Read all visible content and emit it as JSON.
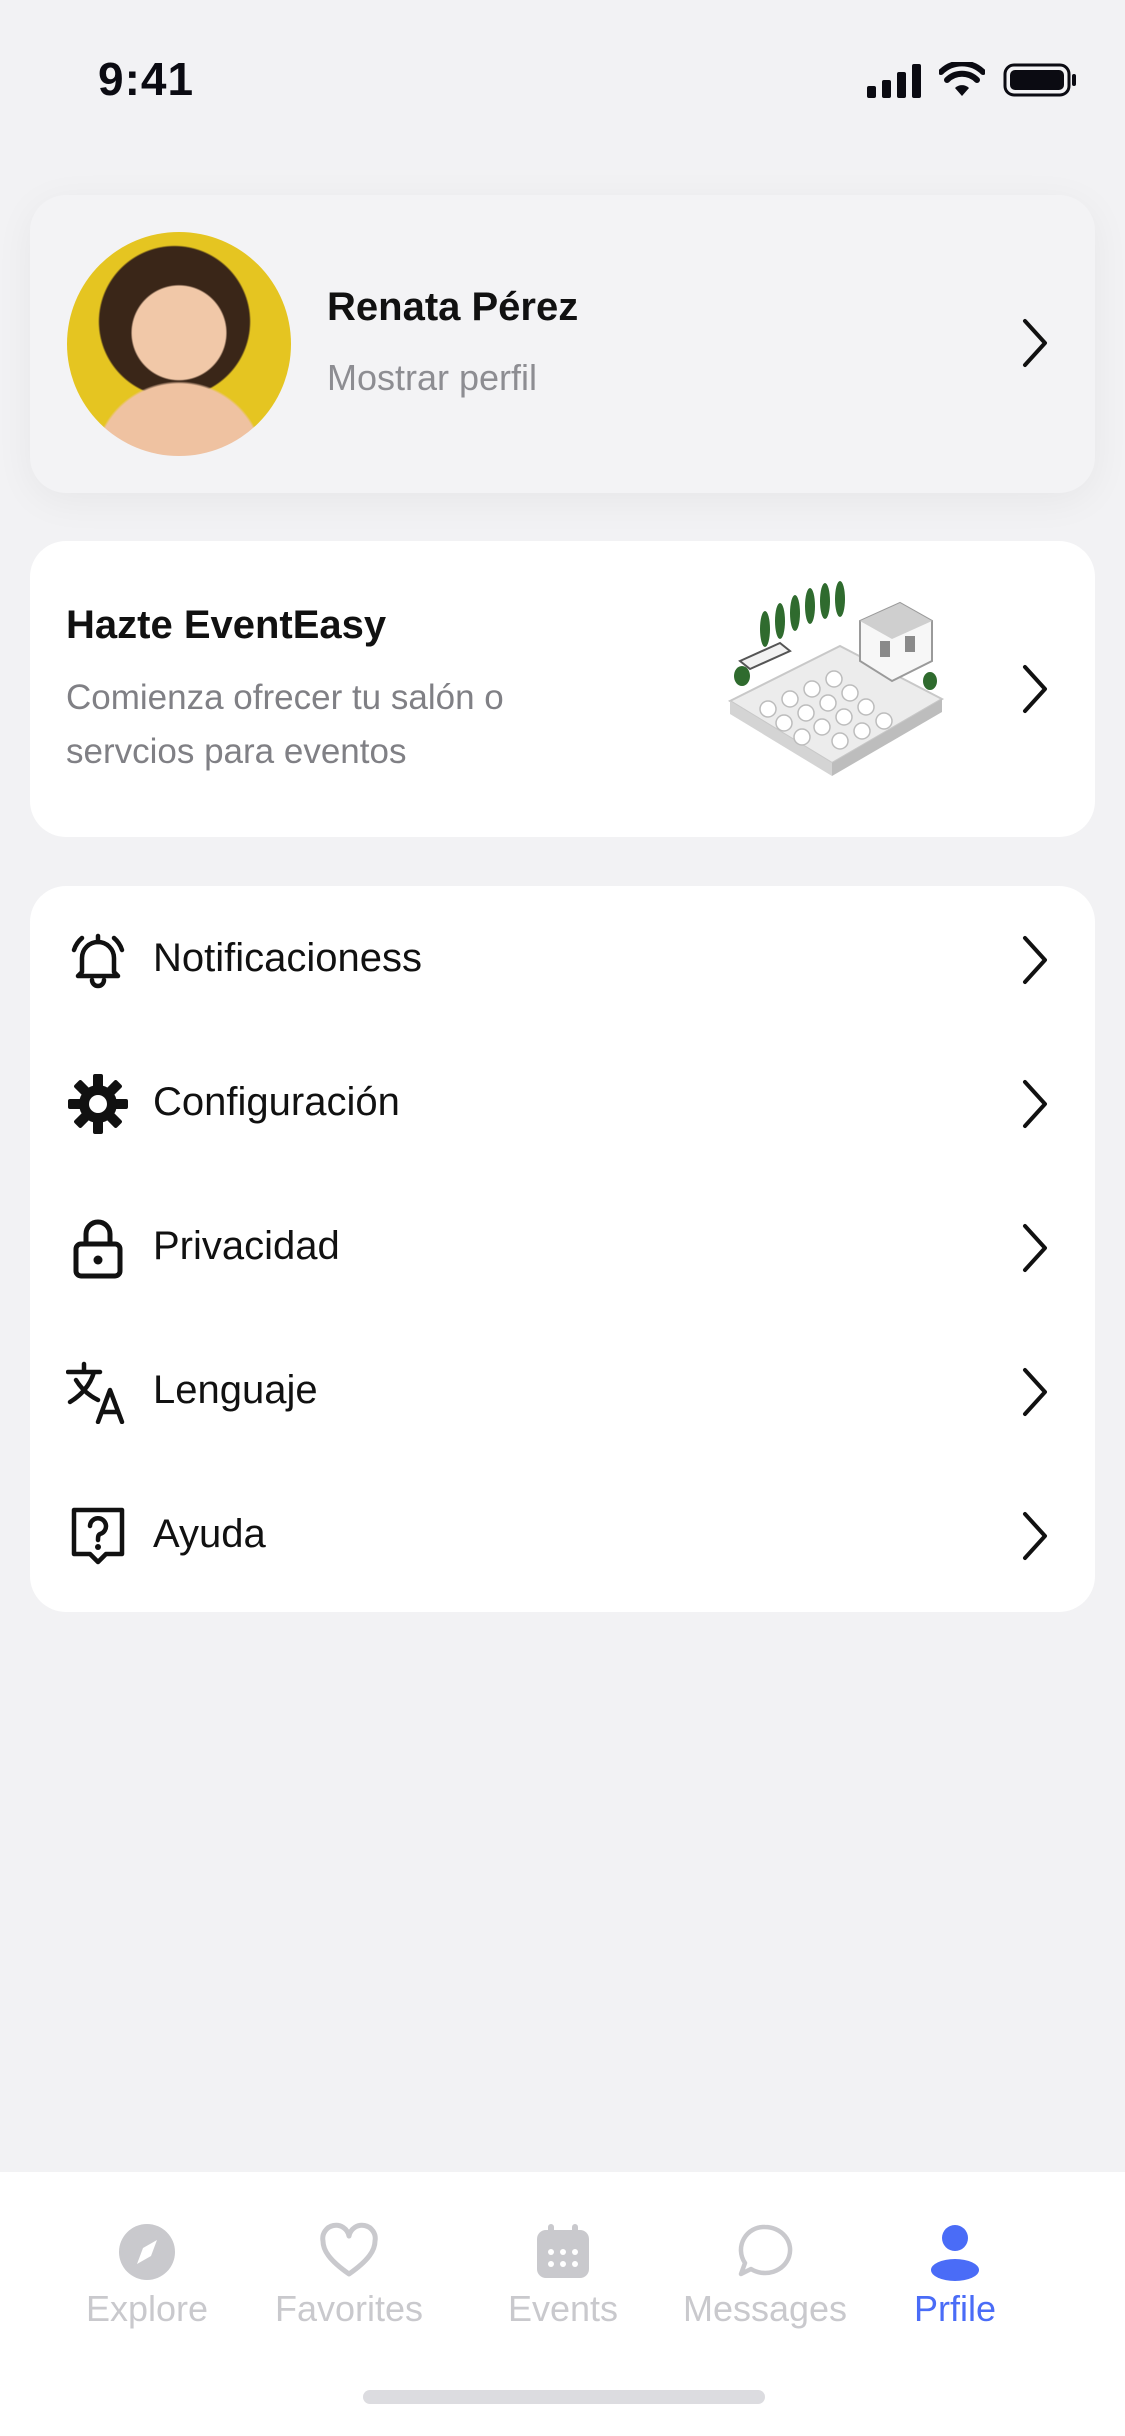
{
  "status_bar": {
    "time": "9:41"
  },
  "profile": {
    "name": "Renata Pérez",
    "subtitle": "Mostrar perfil"
  },
  "promo": {
    "title": "Hazte EventEasy",
    "description": "Comienza ofrecer tu salón o servcios para eventos"
  },
  "menu": {
    "items": [
      {
        "label": "Notificacioness",
        "icon": "bell-icon"
      },
      {
        "label": "Configuración",
        "icon": "gear-icon"
      },
      {
        "label": "Privacidad",
        "icon": "lock-icon"
      },
      {
        "label": "Lenguaje",
        "icon": "translate-icon"
      },
      {
        "label": "Ayuda",
        "icon": "help-icon"
      }
    ]
  },
  "tab_bar": {
    "tabs": [
      {
        "label": "Explore",
        "icon": "compass-icon",
        "active": false
      },
      {
        "label": "Favorites",
        "icon": "heart-icon",
        "active": false
      },
      {
        "label": "Events",
        "icon": "calendar-icon",
        "active": false
      },
      {
        "label": "Messages",
        "icon": "chat-bubble-icon",
        "active": false
      },
      {
        "label": "Prfile",
        "icon": "person-icon",
        "active": true
      }
    ],
    "active_color": "#4a6cf7",
    "inactive_color": "#c9c9cd"
  }
}
